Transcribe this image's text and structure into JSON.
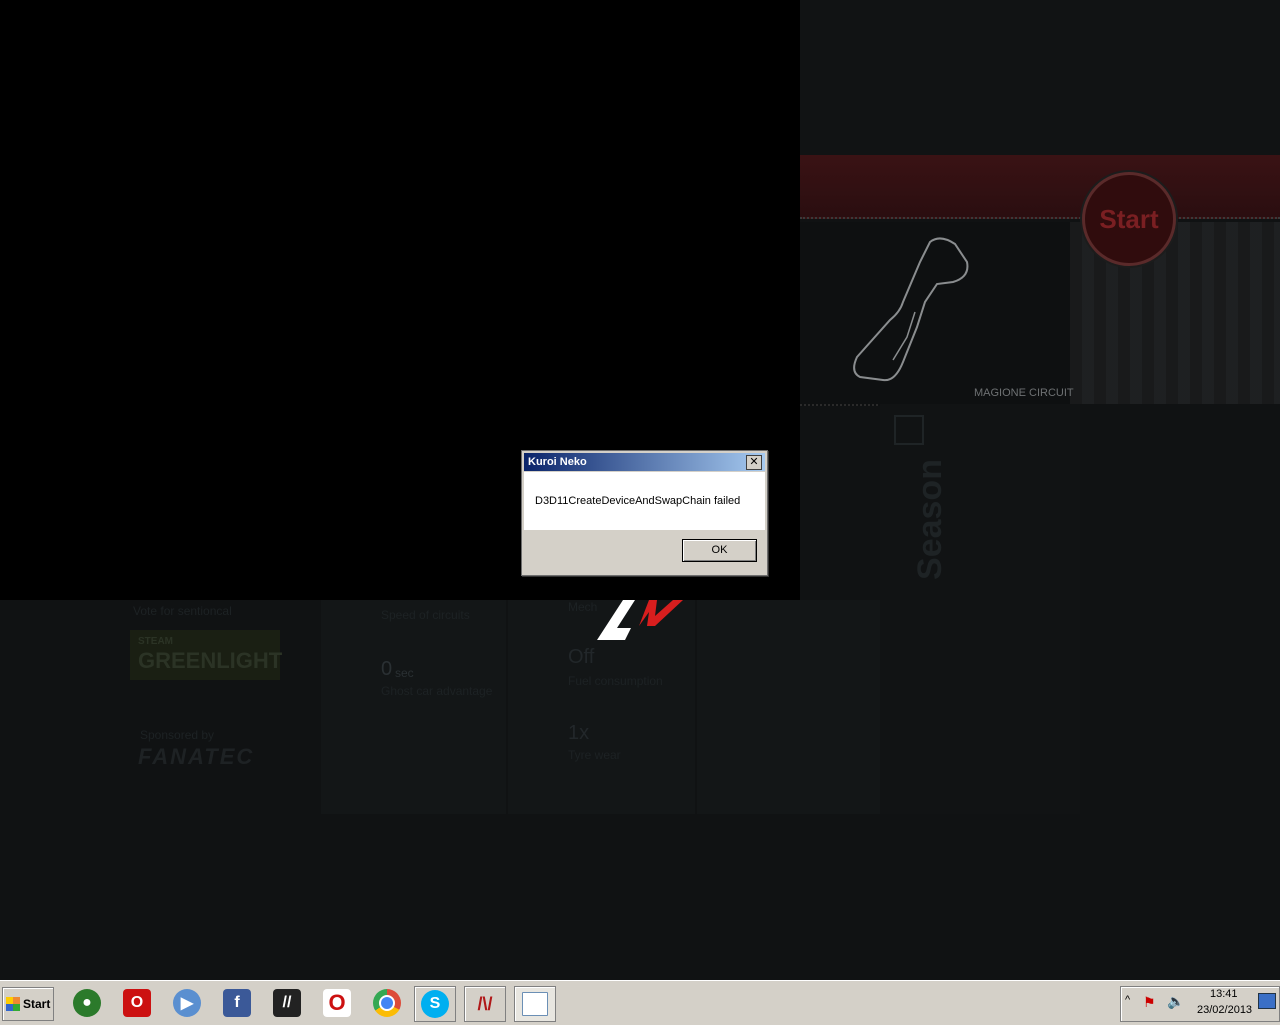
{
  "background": {
    "track_name": "MAGIONE CIRCUIT",
    "start_label": "Start",
    "season_label": "Season",
    "vote_text": "Vote for sentioncal",
    "greenlight_small": "STEAM",
    "greenlight_label": "GREENLIGHT",
    "sponsored_text": "Sponsored by",
    "fanatec_label": "FANATEC",
    "speed_label": "Speed of circuits",
    "ghost_value": "0",
    "ghost_unit": "sec",
    "ghost_label": "Ghost car advantage",
    "mech_label": "Mech",
    "fuel_value": "Off",
    "fuel_label": "Fuel consumption",
    "tyre_value": "1x",
    "tyre_label": "Tyre wear"
  },
  "dialog": {
    "title": "Kuroi Neko",
    "close_glyph": "✕",
    "message": "D3D11CreateDeviceAndSwapChain failed",
    "ok_label": "OK"
  },
  "taskbar": {
    "start_label": "Start",
    "apps": [
      {
        "name": "obs-icon",
        "color": "#2b7a2b"
      },
      {
        "name": "opera-icon",
        "color": "#cc1111"
      },
      {
        "name": "media-player-icon",
        "color": "#5a8fd0"
      },
      {
        "name": "facebook-icon",
        "color": "#3b5998"
      },
      {
        "name": "app-icon",
        "color": "#222222"
      },
      {
        "name": "opera-icon",
        "color": "#cc1111"
      },
      {
        "name": "chrome-icon",
        "color": "#dd4b39"
      },
      {
        "name": "skype-icon",
        "color": "#00aff0"
      },
      {
        "name": "assetto-corsa-icon",
        "color": "#b01818"
      },
      {
        "name": "window-icon",
        "color": "#6b8fb5"
      }
    ],
    "clock_time": "13:41",
    "clock_date": "23/02/2013"
  }
}
